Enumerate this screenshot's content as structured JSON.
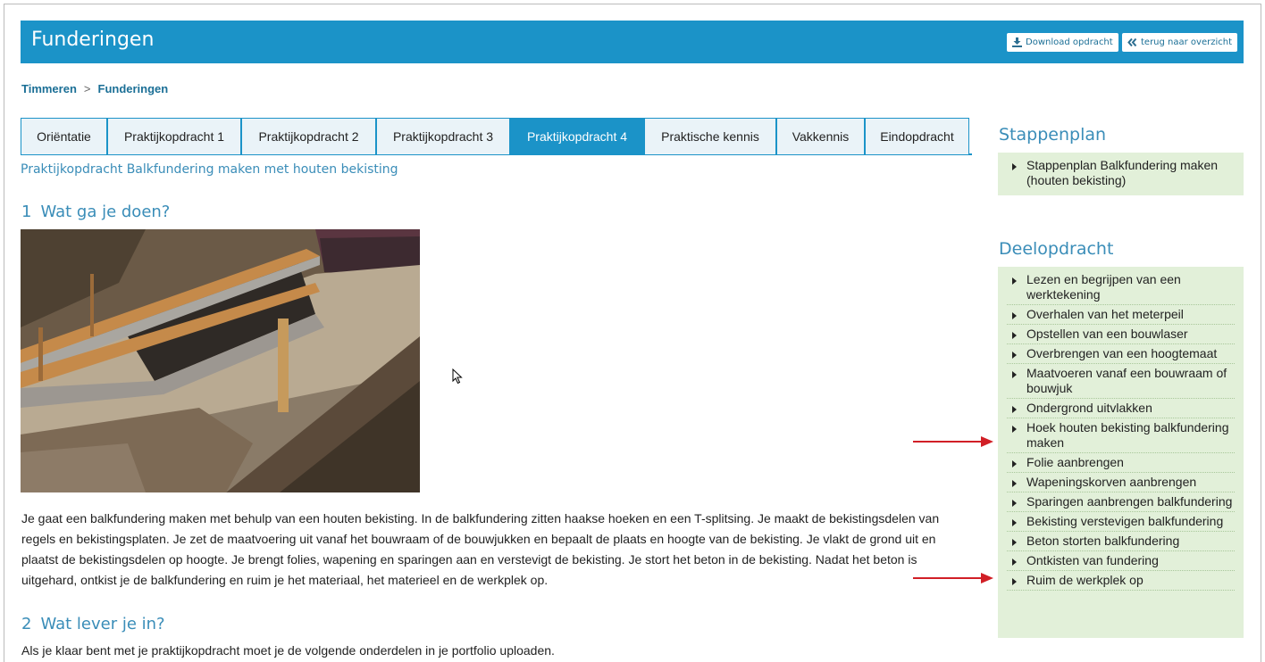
{
  "header": {
    "title": "Funderingen",
    "download_label": "Download opdracht",
    "back_label": "terug naar overzicht"
  },
  "breadcrumb": {
    "items": [
      "Timmeren",
      "Funderingen"
    ],
    "separator": ">"
  },
  "tabs": [
    {
      "label": "Oriëntatie"
    },
    {
      "label": "Praktijkopdracht 1"
    },
    {
      "label": "Praktijkopdracht 2"
    },
    {
      "label": "Praktijkopdracht 3"
    },
    {
      "label": "Praktijkopdracht 4",
      "active": true
    },
    {
      "label": "Praktische kennis"
    },
    {
      "label": "Vakkennis"
    },
    {
      "label": "Eindopdracht"
    }
  ],
  "main": {
    "subtitle": "Praktijkopdracht Balkfundering maken met houten bekisting",
    "section1": {
      "num": "1",
      "title": "Wat ga je doen?"
    },
    "photo_alt": "Houten bekisting balkfundering",
    "paragraph": "Je gaat een balkfundering maken met behulp van een houten bekisting. In de balkfundering zitten haakse hoeken en een T-splitsing. Je maakt de bekistingsdelen van regels en bekistingsplaten. Je zet de maatvoering uit vanaf het bouwraam of de bouwjukken en bepaalt de plaats en hoogte van de bekisting. Je vlakt de grond uit en plaatst de bekistingsdelen op hoogte. Je brengt folies, wapening en sparingen aan en verstevigt de bekisting. Je stort het beton in de bekisting. Nadat het beton is uitgehard, ontkist je de balkfundering en ruim je het materiaal, het materieel en de werkplek op.",
    "section2": {
      "num": "2",
      "title": "Wat lever je in?"
    },
    "paragraph2": "Als je klaar bent met je praktijkopdracht moet je de volgende onderdelen in je portfolio uploaden."
  },
  "sidebar": {
    "stappenplan": {
      "title": "Stappenplan",
      "items": [
        "Stappenplan Balkfundering maken (houten bekisting)"
      ]
    },
    "deelopdracht": {
      "title": "Deelopdracht",
      "items": [
        "Lezen en begrijpen van een werktekening",
        "Overhalen van het meterpeil",
        "Opstellen van een bouwlaser",
        "Overbrengen van een hoogtemaat",
        "Maatvoeren vanaf een bouwraam of bouwjuk",
        "Ondergrond uitvlakken",
        "Hoek houten bekisting balkfundering maken",
        "Folie aanbrengen",
        "Wapeningskorven aanbrengen",
        "Sparingen aanbrengen balkfundering",
        "Bekisting verstevigen balkfundering",
        "Beton storten balkfundering",
        "Ontkisten van fundering",
        "Ruim de werkplek op"
      ]
    }
  },
  "icons": {
    "download": "download-icon",
    "back": "double-chevron-left-icon",
    "bullet": "triangle-right-icon",
    "arrow": "red-arrow-icon",
    "cursor": "mouse-pointer-icon"
  },
  "colors": {
    "header_bg": "#1b93c8",
    "tab_active_bg": "#1b93c8",
    "tab_bg": "#eaf3f8",
    "heading": "#3a8db8",
    "sidebar_bg": "#e2f0d9",
    "annotation_arrow": "#d11f26"
  }
}
